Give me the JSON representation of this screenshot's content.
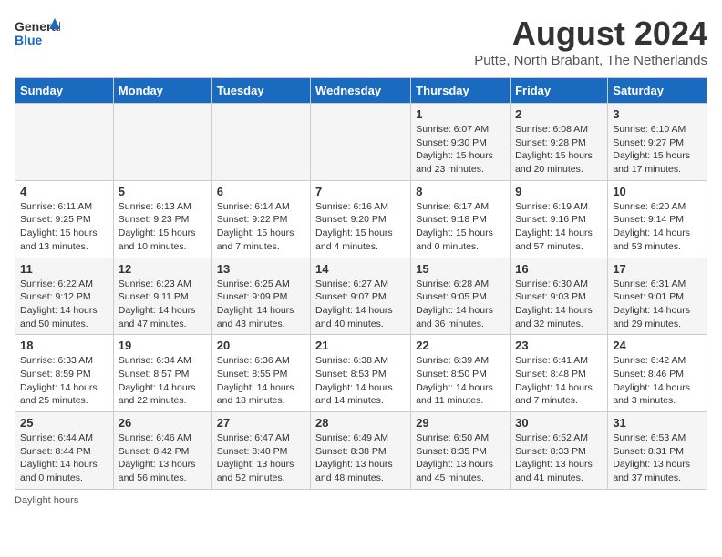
{
  "header": {
    "logo_general": "General",
    "logo_blue": "Blue",
    "main_title": "August 2024",
    "subtitle": "Putte, North Brabant, The Netherlands"
  },
  "days_of_week": [
    "Sunday",
    "Monday",
    "Tuesday",
    "Wednesday",
    "Thursday",
    "Friday",
    "Saturday"
  ],
  "weeks": [
    [
      {
        "day": "",
        "sunrise": "",
        "sunset": "",
        "daylight": ""
      },
      {
        "day": "",
        "sunrise": "",
        "sunset": "",
        "daylight": ""
      },
      {
        "day": "",
        "sunrise": "",
        "sunset": "",
        "daylight": ""
      },
      {
        "day": "",
        "sunrise": "",
        "sunset": "",
        "daylight": ""
      },
      {
        "day": "1",
        "sunrise": "Sunrise: 6:07 AM",
        "sunset": "Sunset: 9:30 PM",
        "daylight": "Daylight: 15 hours and 23 minutes."
      },
      {
        "day": "2",
        "sunrise": "Sunrise: 6:08 AM",
        "sunset": "Sunset: 9:28 PM",
        "daylight": "Daylight: 15 hours and 20 minutes."
      },
      {
        "day": "3",
        "sunrise": "Sunrise: 6:10 AM",
        "sunset": "Sunset: 9:27 PM",
        "daylight": "Daylight: 15 hours and 17 minutes."
      }
    ],
    [
      {
        "day": "4",
        "sunrise": "Sunrise: 6:11 AM",
        "sunset": "Sunset: 9:25 PM",
        "daylight": "Daylight: 15 hours and 13 minutes."
      },
      {
        "day": "5",
        "sunrise": "Sunrise: 6:13 AM",
        "sunset": "Sunset: 9:23 PM",
        "daylight": "Daylight: 15 hours and 10 minutes."
      },
      {
        "day": "6",
        "sunrise": "Sunrise: 6:14 AM",
        "sunset": "Sunset: 9:22 PM",
        "daylight": "Daylight: 15 hours and 7 minutes."
      },
      {
        "day": "7",
        "sunrise": "Sunrise: 6:16 AM",
        "sunset": "Sunset: 9:20 PM",
        "daylight": "Daylight: 15 hours and 4 minutes."
      },
      {
        "day": "8",
        "sunrise": "Sunrise: 6:17 AM",
        "sunset": "Sunset: 9:18 PM",
        "daylight": "Daylight: 15 hours and 0 minutes."
      },
      {
        "day": "9",
        "sunrise": "Sunrise: 6:19 AM",
        "sunset": "Sunset: 9:16 PM",
        "daylight": "Daylight: 14 hours and 57 minutes."
      },
      {
        "day": "10",
        "sunrise": "Sunrise: 6:20 AM",
        "sunset": "Sunset: 9:14 PM",
        "daylight": "Daylight: 14 hours and 53 minutes."
      }
    ],
    [
      {
        "day": "11",
        "sunrise": "Sunrise: 6:22 AM",
        "sunset": "Sunset: 9:12 PM",
        "daylight": "Daylight: 14 hours and 50 minutes."
      },
      {
        "day": "12",
        "sunrise": "Sunrise: 6:23 AM",
        "sunset": "Sunset: 9:11 PM",
        "daylight": "Daylight: 14 hours and 47 minutes."
      },
      {
        "day": "13",
        "sunrise": "Sunrise: 6:25 AM",
        "sunset": "Sunset: 9:09 PM",
        "daylight": "Daylight: 14 hours and 43 minutes."
      },
      {
        "day": "14",
        "sunrise": "Sunrise: 6:27 AM",
        "sunset": "Sunset: 9:07 PM",
        "daylight": "Daylight: 14 hours and 40 minutes."
      },
      {
        "day": "15",
        "sunrise": "Sunrise: 6:28 AM",
        "sunset": "Sunset: 9:05 PM",
        "daylight": "Daylight: 14 hours and 36 minutes."
      },
      {
        "day": "16",
        "sunrise": "Sunrise: 6:30 AM",
        "sunset": "Sunset: 9:03 PM",
        "daylight": "Daylight: 14 hours and 32 minutes."
      },
      {
        "day": "17",
        "sunrise": "Sunrise: 6:31 AM",
        "sunset": "Sunset: 9:01 PM",
        "daylight": "Daylight: 14 hours and 29 minutes."
      }
    ],
    [
      {
        "day": "18",
        "sunrise": "Sunrise: 6:33 AM",
        "sunset": "Sunset: 8:59 PM",
        "daylight": "Daylight: 14 hours and 25 minutes."
      },
      {
        "day": "19",
        "sunrise": "Sunrise: 6:34 AM",
        "sunset": "Sunset: 8:57 PM",
        "daylight": "Daylight: 14 hours and 22 minutes."
      },
      {
        "day": "20",
        "sunrise": "Sunrise: 6:36 AM",
        "sunset": "Sunset: 8:55 PM",
        "daylight": "Daylight: 14 hours and 18 minutes."
      },
      {
        "day": "21",
        "sunrise": "Sunrise: 6:38 AM",
        "sunset": "Sunset: 8:53 PM",
        "daylight": "Daylight: 14 hours and 14 minutes."
      },
      {
        "day": "22",
        "sunrise": "Sunrise: 6:39 AM",
        "sunset": "Sunset: 8:50 PM",
        "daylight": "Daylight: 14 hours and 11 minutes."
      },
      {
        "day": "23",
        "sunrise": "Sunrise: 6:41 AM",
        "sunset": "Sunset: 8:48 PM",
        "daylight": "Daylight: 14 hours and 7 minutes."
      },
      {
        "day": "24",
        "sunrise": "Sunrise: 6:42 AM",
        "sunset": "Sunset: 8:46 PM",
        "daylight": "Daylight: 14 hours and 3 minutes."
      }
    ],
    [
      {
        "day": "25",
        "sunrise": "Sunrise: 6:44 AM",
        "sunset": "Sunset: 8:44 PM",
        "daylight": "Daylight: 14 hours and 0 minutes."
      },
      {
        "day": "26",
        "sunrise": "Sunrise: 6:46 AM",
        "sunset": "Sunset: 8:42 PM",
        "daylight": "Daylight: 13 hours and 56 minutes."
      },
      {
        "day": "27",
        "sunrise": "Sunrise: 6:47 AM",
        "sunset": "Sunset: 8:40 PM",
        "daylight": "Daylight: 13 hours and 52 minutes."
      },
      {
        "day": "28",
        "sunrise": "Sunrise: 6:49 AM",
        "sunset": "Sunset: 8:38 PM",
        "daylight": "Daylight: 13 hours and 48 minutes."
      },
      {
        "day": "29",
        "sunrise": "Sunrise: 6:50 AM",
        "sunset": "Sunset: 8:35 PM",
        "daylight": "Daylight: 13 hours and 45 minutes."
      },
      {
        "day": "30",
        "sunrise": "Sunrise: 6:52 AM",
        "sunset": "Sunset: 8:33 PM",
        "daylight": "Daylight: 13 hours and 41 minutes."
      },
      {
        "day": "31",
        "sunrise": "Sunrise: 6:53 AM",
        "sunset": "Sunset: 8:31 PM",
        "daylight": "Daylight: 13 hours and 37 minutes."
      }
    ]
  ],
  "footer": {
    "note": "Daylight hours"
  }
}
